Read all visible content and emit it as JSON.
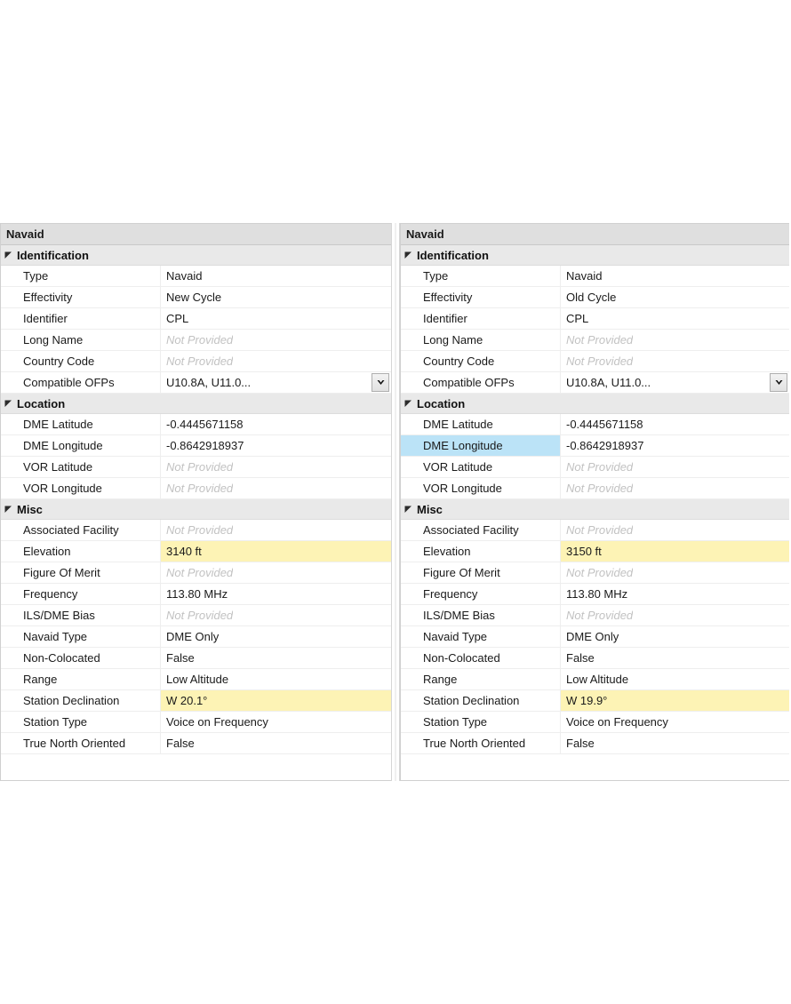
{
  "panels": [
    {
      "title": "Navaid",
      "groups": [
        {
          "label": "Identification",
          "rows": [
            {
              "label": "Type",
              "value": "Navaid",
              "state": "normal"
            },
            {
              "label": "Effectivity",
              "value": "New Cycle",
              "state": "normal"
            },
            {
              "label": "Identifier",
              "value": "CPL",
              "state": "normal"
            },
            {
              "label": "Long Name",
              "value": "Not Provided",
              "state": "placeholder"
            },
            {
              "label": "Country Code",
              "value": "Not Provided",
              "state": "placeholder"
            },
            {
              "label": "Compatible OFPs",
              "value": "U10.8A, U11.0...",
              "state": "normal",
              "dropdown": true
            }
          ]
        },
        {
          "label": "Location",
          "rows": [
            {
              "label": "DME Latitude",
              "value": "-0.4445671158",
              "state": "normal"
            },
            {
              "label": "DME Longitude",
              "value": "-0.8642918937",
              "state": "normal"
            },
            {
              "label": "VOR Latitude",
              "value": "Not Provided",
              "state": "placeholder"
            },
            {
              "label": "VOR Longitude",
              "value": "Not Provided",
              "state": "placeholder"
            }
          ]
        },
        {
          "label": "Misc",
          "rows": [
            {
              "label": "Associated Facility",
              "value": "Not Provided",
              "state": "placeholder"
            },
            {
              "label": "Elevation",
              "value": "3140 ft",
              "state": "changed"
            },
            {
              "label": "Figure Of Merit",
              "value": "Not Provided",
              "state": "placeholder"
            },
            {
              "label": "Frequency",
              "value": "113.80 MHz",
              "state": "normal"
            },
            {
              "label": "ILS/DME Bias",
              "value": "Not Provided",
              "state": "placeholder"
            },
            {
              "label": "Navaid Type",
              "value": "DME Only",
              "state": "normal"
            },
            {
              "label": "Non-Colocated",
              "value": "False",
              "state": "normal"
            },
            {
              "label": "Range",
              "value": "Low Altitude",
              "state": "normal"
            },
            {
              "label": "Station Declination",
              "value": "W 20.1°",
              "state": "changed"
            },
            {
              "label": "Station Type",
              "value": "Voice on Frequency",
              "state": "normal"
            },
            {
              "label": "True North Oriented",
              "value": "False",
              "state": "normal"
            }
          ]
        }
      ]
    },
    {
      "title": "Navaid",
      "groups": [
        {
          "label": "Identification",
          "rows": [
            {
              "label": "Type",
              "value": "Navaid",
              "state": "normal"
            },
            {
              "label": "Effectivity",
              "value": "Old Cycle",
              "state": "normal"
            },
            {
              "label": "Identifier",
              "value": "CPL",
              "state": "normal"
            },
            {
              "label": "Long Name",
              "value": "Not Provided",
              "state": "placeholder"
            },
            {
              "label": "Country Code",
              "value": "Not Provided",
              "state": "placeholder"
            },
            {
              "label": "Compatible OFPs",
              "value": "U10.8A, U11.0...",
              "state": "normal",
              "dropdown": true
            }
          ]
        },
        {
          "label": "Location",
          "rows": [
            {
              "label": "DME Latitude",
              "value": "-0.4445671158",
              "state": "normal"
            },
            {
              "label": "DME Longitude",
              "value": "-0.8642918937",
              "state": "normal",
              "label_selected": true
            },
            {
              "label": "VOR Latitude",
              "value": "Not Provided",
              "state": "placeholder"
            },
            {
              "label": "VOR Longitude",
              "value": "Not Provided",
              "state": "placeholder"
            }
          ]
        },
        {
          "label": "Misc",
          "rows": [
            {
              "label": "Associated Facility",
              "value": "Not Provided",
              "state": "placeholder"
            },
            {
              "label": "Elevation",
              "value": "3150 ft",
              "state": "changed"
            },
            {
              "label": "Figure Of Merit",
              "value": "Not Provided",
              "state": "placeholder"
            },
            {
              "label": "Frequency",
              "value": "113.80 MHz",
              "state": "normal"
            },
            {
              "label": "ILS/DME Bias",
              "value": "Not Provided",
              "state": "placeholder"
            },
            {
              "label": "Navaid Type",
              "value": "DME Only",
              "state": "normal"
            },
            {
              "label": "Non-Colocated",
              "value": "False",
              "state": "normal"
            },
            {
              "label": "Range",
              "value": "Low Altitude",
              "state": "normal"
            },
            {
              "label": "Station Declination",
              "value": "W 19.9°",
              "state": "changed"
            },
            {
              "label": "Station Type",
              "value": "Voice on Frequency",
              "state": "normal"
            },
            {
              "label": "True North Oriented",
              "value": "False",
              "state": "normal"
            }
          ]
        }
      ]
    }
  ],
  "icons": {
    "group_expander": "triangle-expanded-icon",
    "dropdown": "chevron-down-icon"
  },
  "colors": {
    "changed_highlight": "#fdf3b5",
    "selection_highlight": "#bbe3f7",
    "group_header_bg": "#e9e9e9",
    "panel_title_bg": "#dfdfdf",
    "placeholder_text": "#c2c2c2"
  }
}
